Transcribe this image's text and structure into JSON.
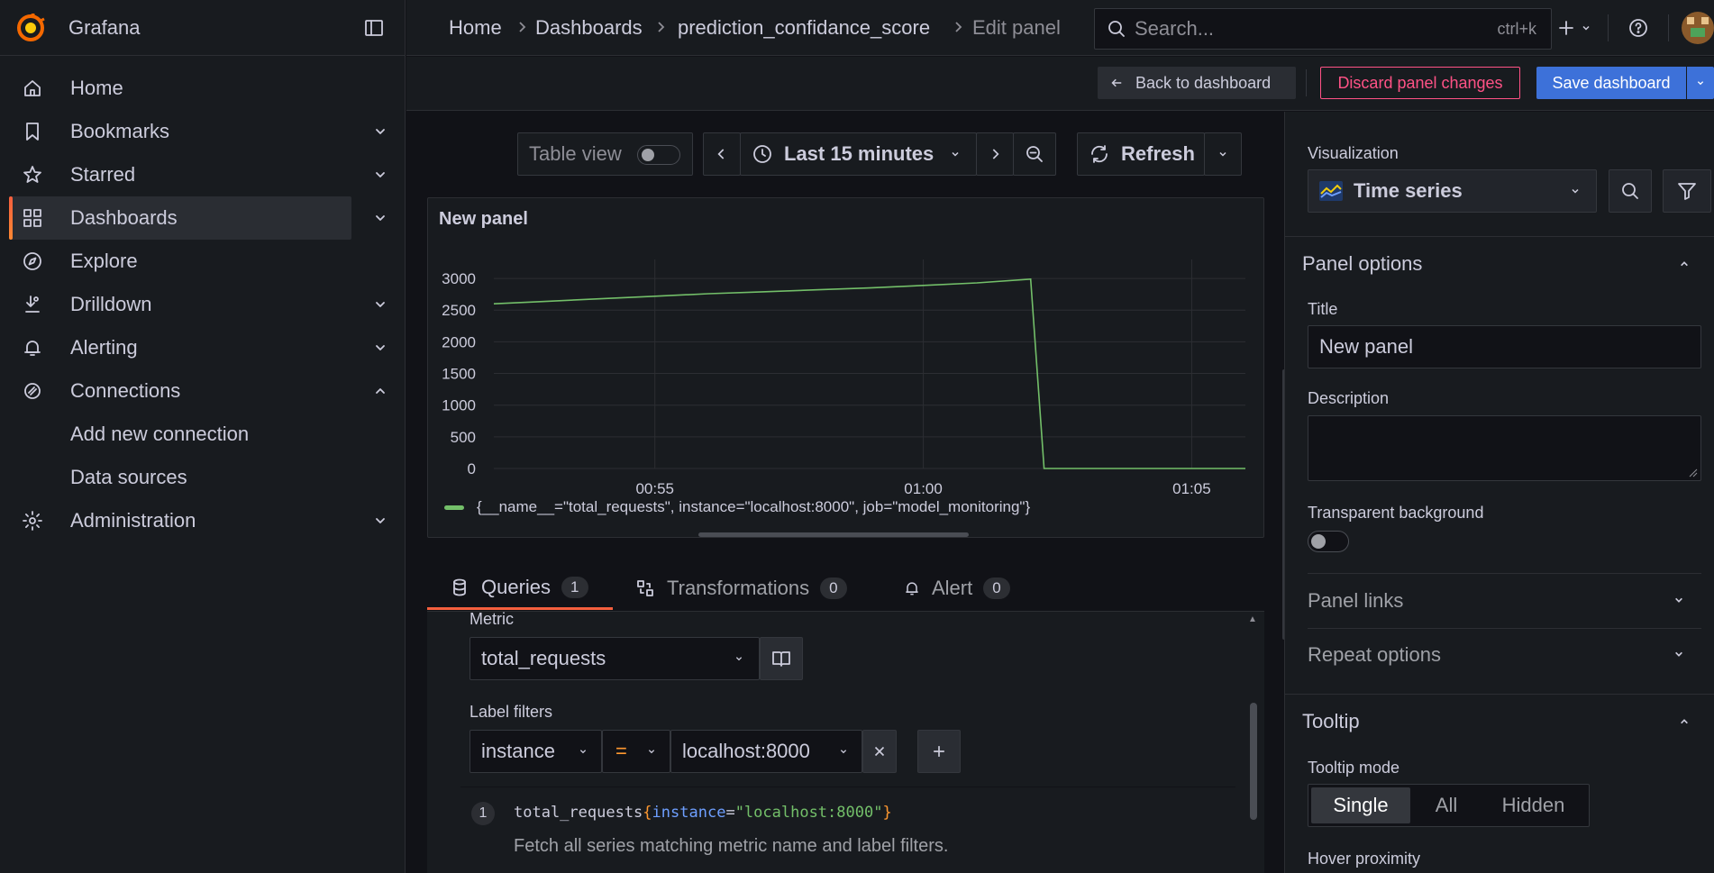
{
  "app": {
    "name": "Grafana"
  },
  "sidebar": {
    "items": [
      {
        "label": "Home",
        "icon": "home-icon"
      },
      {
        "label": "Bookmarks",
        "icon": "bookmark-icon"
      },
      {
        "label": "Starred",
        "icon": "star-icon"
      },
      {
        "label": "Dashboards",
        "icon": "dashboards-icon"
      },
      {
        "label": "Explore",
        "icon": "compass-icon"
      },
      {
        "label": "Drilldown",
        "icon": "drilldown-icon"
      },
      {
        "label": "Alerting",
        "icon": "bell-icon"
      },
      {
        "label": "Connections",
        "icon": "connections-icon"
      },
      {
        "label": "Add new connection"
      },
      {
        "label": "Data sources"
      },
      {
        "label": "Administration",
        "icon": "gear-icon"
      }
    ]
  },
  "breadcrumb": [
    "Home",
    "Dashboards",
    "prediction_confidance_score",
    "Edit panel"
  ],
  "search": {
    "placeholder": "Search...",
    "shortcut": "ctrl+k"
  },
  "toolbar": {
    "back": "Back to dashboard",
    "discard": "Discard panel changes",
    "save": "Save dashboard"
  },
  "controls": {
    "table_view": "Table view",
    "time_range": "Last 15 minutes",
    "refresh": "Refresh"
  },
  "panel": {
    "title": "New panel"
  },
  "chart_data": {
    "type": "line",
    "title": "New panel",
    "x": [
      "00:52",
      "00:53",
      "00:54",
      "00:55",
      "00:56",
      "00:57",
      "00:58",
      "00:59",
      "01:00",
      "01:01",
      "01:02",
      "01:02",
      "01:03",
      "01:04",
      "01:05",
      "01:06"
    ],
    "series": [
      {
        "name": "{__name__=\"total_requests\", instance=\"localhost:8000\", job=\"model_monitoring\"}",
        "values": [
          2600,
          2640,
          2680,
          2720,
          2760,
          2790,
          2820,
          2850,
          2890,
          2930,
          2990,
          0,
          0,
          0,
          0,
          0
        ],
        "color": "#73bf69"
      }
    ],
    "xticks": [
      "00:55",
      "01:00",
      "01:05"
    ],
    "yticks": [
      0,
      500,
      1000,
      1500,
      2000,
      2500,
      3000
    ],
    "ylim": [
      0,
      3300
    ],
    "grid": true,
    "legend": "bottom-left"
  },
  "tabs": [
    {
      "label": "Queries",
      "count": "1"
    },
    {
      "label": "Transformations",
      "count": "0"
    },
    {
      "label": "Alert",
      "count": "0"
    }
  ],
  "query": {
    "metric_label": "Metric",
    "metric_value": "total_requests",
    "label_filters_label": "Label filters",
    "filter_key": "instance",
    "filter_op": "=",
    "filter_value": "localhost:8000",
    "line_no": "1",
    "code_metric": "total_requests",
    "code_open": "{",
    "code_key": "instance",
    "code_eq": "=",
    "code_val": "\"localhost:8000\"",
    "code_close": "}",
    "hint": "Fetch all series matching metric name and label filters."
  },
  "options": {
    "visualization_label": "Visualization",
    "visualization_value": "Time series",
    "panel_options": "Panel options",
    "title_label": "Title",
    "title_value": "New panel",
    "description_label": "Description",
    "transparent_label": "Transparent background",
    "panel_links": "Panel links",
    "repeat_options": "Repeat options",
    "tooltip": "Tooltip",
    "tooltip_mode_label": "Tooltip mode",
    "tooltip_modes": [
      "Single",
      "All",
      "Hidden"
    ],
    "hover_proximity": "Hover proximity"
  },
  "colors": {
    "accent": "#3d71d9",
    "danger": "#ff5286",
    "series": "#73bf69",
    "active_bar": "#f55f3e"
  }
}
